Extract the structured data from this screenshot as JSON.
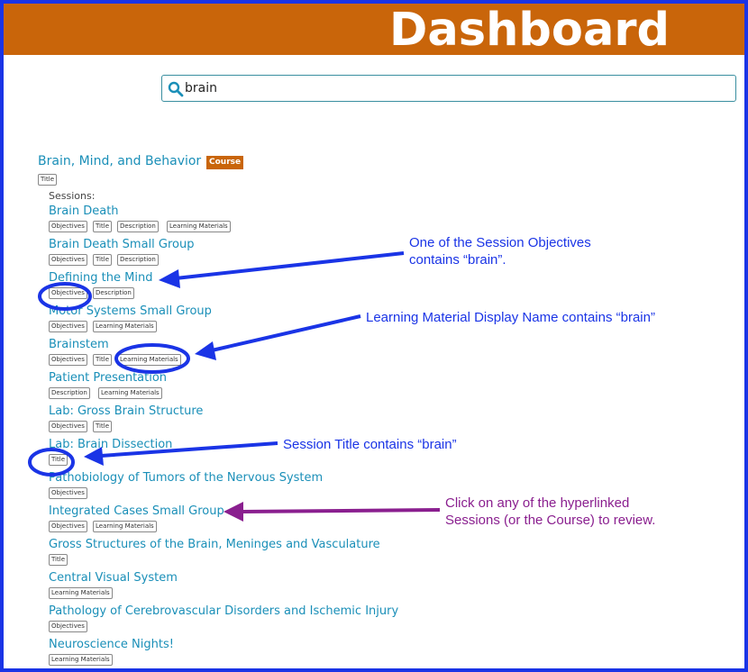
{
  "header": {
    "title": "Dashboard"
  },
  "search": {
    "value": "brain"
  },
  "course": {
    "title": "Brain, Mind, and Behavior",
    "badge": "Course",
    "tags": [
      "Title"
    ]
  },
  "sessions_label": "Sessions:",
  "sessions": [
    {
      "title": "Brain Death",
      "tags": [
        "Objectives",
        "Title",
        "Description",
        "Learning Materials"
      ]
    },
    {
      "title": "Brain Death Small Group",
      "tags": [
        "Objectives",
        "Title",
        "Description"
      ]
    },
    {
      "title": "Defining the Mind",
      "tags": [
        "Objectives",
        "Description"
      ]
    },
    {
      "title": "Motor Systems Small Group",
      "tags": [
        "Objectives",
        "Learning Materials"
      ]
    },
    {
      "title": "Brainstem",
      "tags": [
        "Objectives",
        "Title",
        "Learning Materials"
      ]
    },
    {
      "title": "Patient Presentation",
      "tags": [
        "Description",
        "Learning Materials"
      ]
    },
    {
      "title": "Lab: Gross Brain Structure",
      "tags": [
        "Objectives",
        "Title"
      ]
    },
    {
      "title": "Lab: Brain Dissection",
      "tags": [
        "Title"
      ]
    },
    {
      "title": "Pathobiology of Tumors of the Nervous System",
      "tags": [
        "Objectives"
      ]
    },
    {
      "title": "Integrated Cases Small Group",
      "tags": [
        "Objectives",
        "Learning Materials"
      ]
    },
    {
      "title": "Gross Structures of the Brain, Meninges and Vasculature",
      "tags": [
        "Title"
      ]
    },
    {
      "title": "Central Visual System",
      "tags": [
        "Learning Materials"
      ]
    },
    {
      "title": "Pathology of Cerebrovascular Disorders and Ischemic Injury",
      "tags": [
        "Objectives"
      ]
    },
    {
      "title": "Neuroscience Nights!",
      "tags": [
        "Learning Materials"
      ]
    }
  ],
  "annotations": {
    "objectives_note": [
      "One of the Session Objectives",
      "contains “brain”."
    ],
    "materials_note": "Learning Material Display Name contains “brain”",
    "title_note": "Session Title contains “brain”",
    "click_note": [
      "Click on any of the hyperlinked",
      "Sessions (or the Course) to review."
    ]
  },
  "colors": {
    "header": "#c9650a",
    "link": "#1a8fb8",
    "annotation_blue": "#1a34e6",
    "annotation_purple": "#8a1f8f"
  },
  "icons": {
    "search": "search-icon"
  }
}
